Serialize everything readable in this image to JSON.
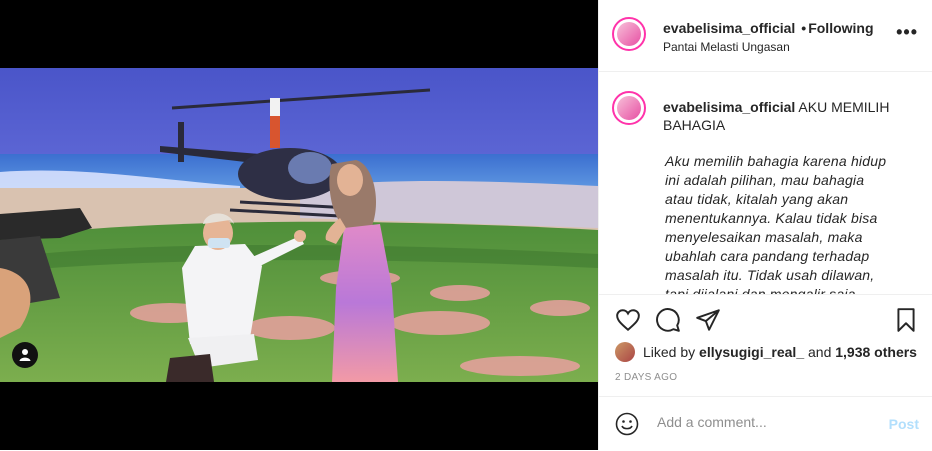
{
  "post": {
    "username": "evabelisima_official",
    "follow_status": "Following",
    "location": "Pantai Melasti Ungasan",
    "caption_title": "AKU MEMILIH BAHAGIA",
    "caption_body": "Aku memilih bahagia karena hidup\nini adalah pilihan, mau bahagia\natau tidak, kitalah yang akan\nmenentukannya. Kalau tidak bisa\nmenyelesaikan masalah, maka\nubahlah cara pandang terhadap\nmasalah itu. Tidak usah dilawan,\ntapi dijalani dan mengalir saja.",
    "liked_by_prefix": "Liked by",
    "liked_by_user": "ellysugigi_real_",
    "liked_by_and": "and",
    "likes_others": "1,938 others",
    "time_ago": "2 DAYS AGO"
  },
  "composer": {
    "placeholder": "Add a comment...",
    "post_label": "Post"
  },
  "icons": {
    "more": "more-options-icon",
    "like": "heart-icon",
    "comment": "comment-icon",
    "share": "share-icon",
    "save": "bookmark-icon",
    "emoji": "emoji-icon",
    "user_tag": "user-icon"
  },
  "colors": {
    "post_button": "#b2dffc",
    "secondary_text": "#8e8e8e"
  }
}
